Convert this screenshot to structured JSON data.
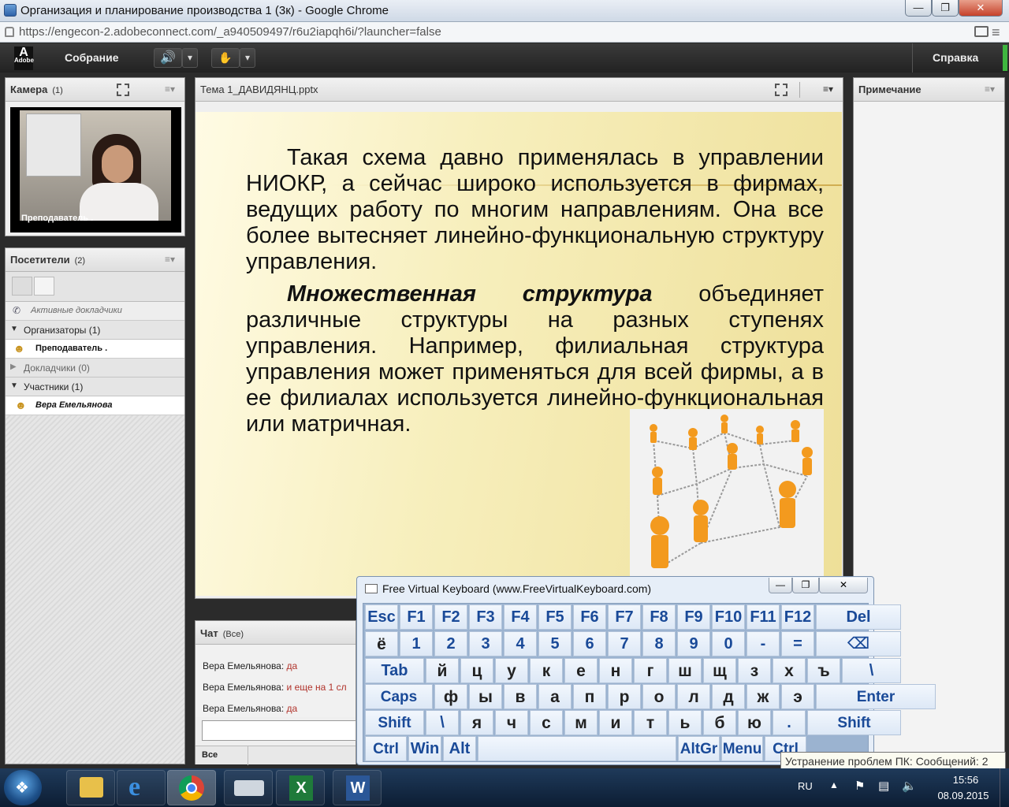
{
  "window": {
    "title": "Организация и планирование производства 1 (3к) - Google Chrome"
  },
  "browser": {
    "url": "https://engecon-2.adobeconnect.com/_a940509497/r6u2iapqh6i/?launcher=false"
  },
  "connect_bar": {
    "logo": "Adobe",
    "meeting_menu": "Собрание",
    "help_menu": "Справка"
  },
  "camera_pod": {
    "title": "Камера",
    "count": "(1)",
    "overlay_label": "Преподаватель ."
  },
  "attendees_pod": {
    "title": "Посетители",
    "count": "(2)",
    "active_speakers": "Активные докладчики",
    "groups": [
      {
        "label": "Организаторы (1)",
        "members": [
          "Преподаватель ."
        ]
      },
      {
        "label": "Докладчики (0)",
        "members": []
      },
      {
        "label": "Участники (1)",
        "members": [
          "Вера Емельянова"
        ]
      }
    ]
  },
  "share_pod": {
    "title": "Тема 1_ДАВИДЯНЦ.pptx",
    "slide": {
      "para1": "Такая схема давно применялась в управлении НИОКР, а сейчас широко используется в фирмах, ведущих работу по  многим направлениям. Она все более вытесняет линейно-функциональную структуру управления.",
      "para2_bold": "Множественная структура",
      "para2_rest": " объединяет различные структуры на разных ступенях управления. Например, филиальная структура управления может применяться для всей фирмы, а в ее филиалах используется линейно-функциональная или матричная."
    }
  },
  "notes_pod": {
    "title": "Примечание"
  },
  "chat_pod": {
    "title": "Чат",
    "scope": "(Все)",
    "messages": [
      {
        "sender": "Вера Емельянова:",
        "text": "да"
      },
      {
        "sender": "Вера Емельянова:",
        "text": "и еще на 1 сл"
      },
      {
        "sender": "Вера Емельянова:",
        "text": "да"
      }
    ],
    "input_placeholder": "",
    "recipient": "Все"
  },
  "keyboard": {
    "title": "Free Virtual Keyboard (www.FreeVirtualKeyboard.com)",
    "rows": [
      [
        "Esc",
        "F1",
        "F2",
        "F3",
        "F4",
        "F5",
        "F6",
        "F7",
        "F8",
        "F9",
        "F10",
        "F11",
        "F12",
        "Del"
      ],
      [
        "ё",
        "1",
        "2",
        "3",
        "4",
        "5",
        "6",
        "7",
        "8",
        "9",
        "0",
        "-",
        "=",
        "⌫"
      ],
      [
        "Tab",
        "й",
        "ц",
        "у",
        "к",
        "е",
        "н",
        "г",
        "ш",
        "щ",
        "з",
        "х",
        "ъ",
        "\\"
      ],
      [
        "Caps",
        "ф",
        "ы",
        "в",
        "а",
        "п",
        "р",
        "о",
        "л",
        "д",
        "ж",
        "э",
        "Enter"
      ],
      [
        "Shift",
        "\\",
        "я",
        "ч",
        "с",
        "м",
        "и",
        "т",
        "ь",
        "б",
        "ю",
        ".",
        "Shift"
      ],
      [
        "Ctrl",
        "Win",
        "Alt",
        "",
        "AltGr",
        "Menu",
        "Ctrl"
      ]
    ]
  },
  "taskbar": {
    "lang": "RU",
    "time": "15:56",
    "date": "08.09.2015",
    "tooltip": "Устранение проблем ПК: Сообщений: 2"
  },
  "colors": {
    "accent_green": "#3fb63f",
    "chat_msg": "#b0322a",
    "key_text": "#1a4a98",
    "slide_bg": "#f7efbd"
  }
}
